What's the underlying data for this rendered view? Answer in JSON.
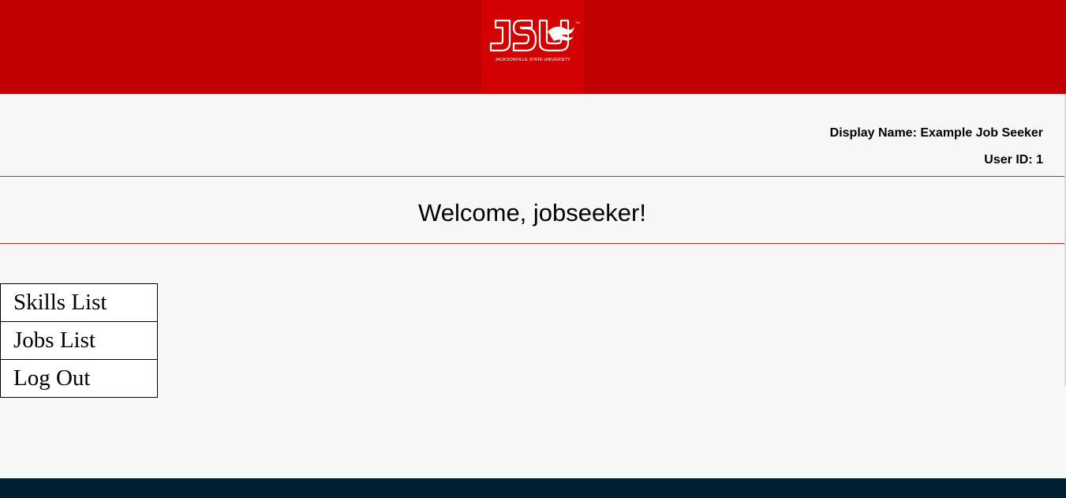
{
  "brand": {
    "logo_text": "JSU",
    "logo_subtext": "JACKSONVILLE STATE UNIVERSITY",
    "header_color": "#c00000",
    "logo_bg_color": "#d20000",
    "footer_color": "#002033",
    "accent_rule_color": "#d42424"
  },
  "user": {
    "display_name_line": "Display Name: Example Job Seeker",
    "user_id_line": "User ID: 1"
  },
  "main": {
    "welcome": "Welcome, jobseeker!"
  },
  "nav": {
    "items": [
      {
        "label": "Skills List"
      },
      {
        "label": "Jobs List"
      },
      {
        "label": "Log Out"
      }
    ]
  }
}
